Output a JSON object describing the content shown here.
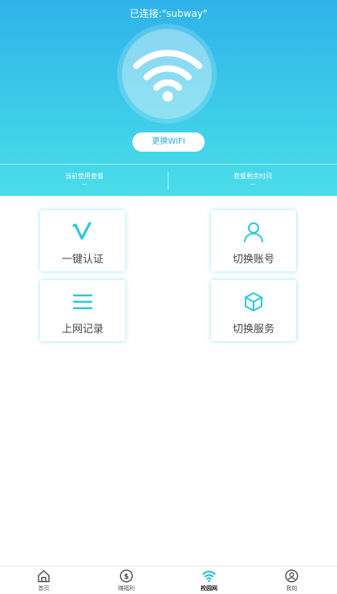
{
  "header": {
    "title": "已连接:\"subway\"",
    "switch_wifi_label": "更换WIFI",
    "stats": [
      {
        "label": "当前使用套餐",
        "value": "--"
      },
      {
        "label": "套餐剩余时间",
        "value": "--"
      }
    ]
  },
  "grid": {
    "items": [
      {
        "label": "一键认证",
        "icon": "v-check-icon"
      },
      {
        "label": "切换账号",
        "icon": "user-icon"
      },
      {
        "label": "上网记录",
        "icon": "list-icon"
      },
      {
        "label": "切换服务",
        "icon": "cube-icon"
      }
    ]
  },
  "tabbar": {
    "items": [
      {
        "label": "首页",
        "icon": "home-icon"
      },
      {
        "label": "赚福利",
        "icon": "coin-icon"
      },
      {
        "label": "校园网",
        "icon": "wifi-icon"
      },
      {
        "label": "我的",
        "icon": "profile-icon"
      }
    ],
    "active_index": 2
  },
  "colors": {
    "header_top": "#2fb2ea",
    "header_bottom": "#4bdde9",
    "accent": "#2ec7e0",
    "tab_active": "#13c0d8",
    "tab_inactive": "#4a4a4a"
  }
}
